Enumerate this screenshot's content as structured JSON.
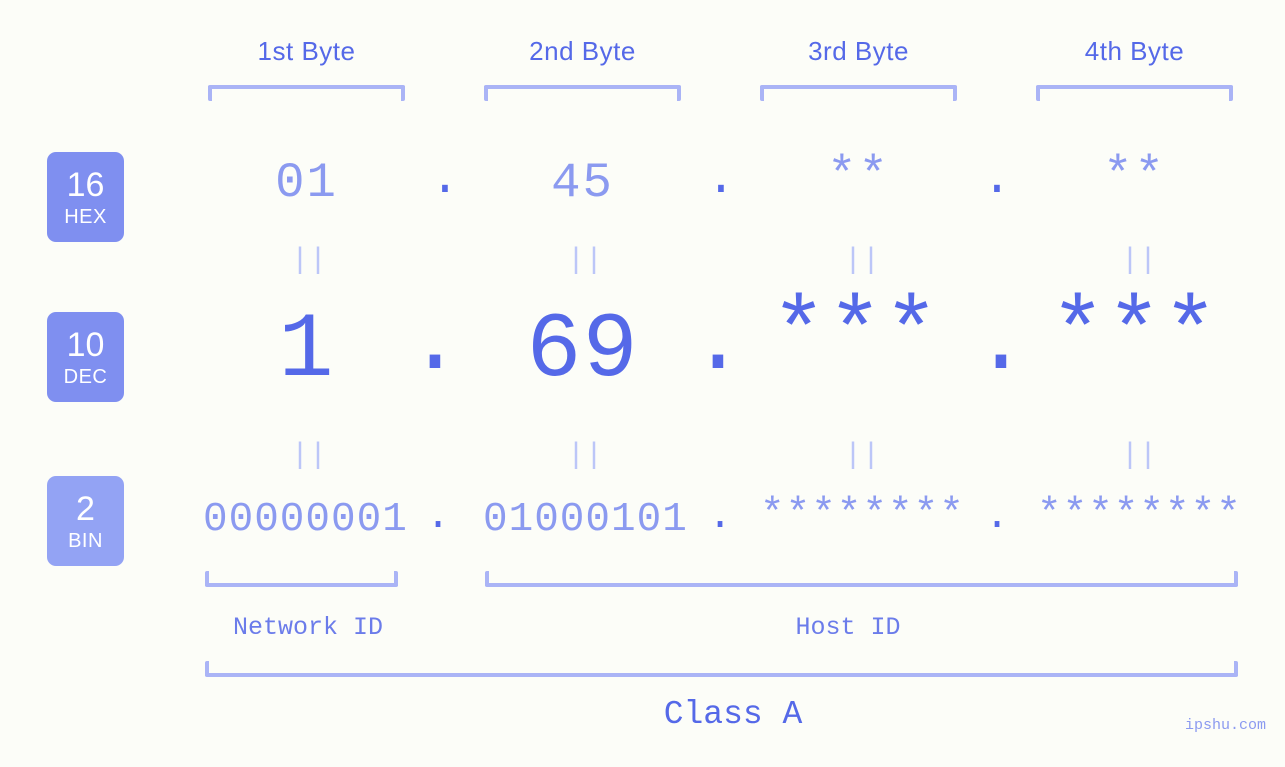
{
  "colors": {
    "background": "#fcfdf8",
    "accent_strong": "#5569e8",
    "accent_mid": "#8b9af0",
    "accent_light": "#aab4f6",
    "accent_faint": "#bcc6f8",
    "badge_hex": "#7f8ff0",
    "badge_dec": "#7f8ff0",
    "badge_bin": "#93a3f4",
    "badge_text": "#ffffff"
  },
  "byte_headers": [
    {
      "label": "1st Byte"
    },
    {
      "label": "2nd Byte"
    },
    {
      "label": "3rd Byte"
    },
    {
      "label": "4th Byte"
    }
  ],
  "rows": {
    "hex": {
      "base": "16",
      "unit": "HEX",
      "values": [
        "01",
        "45",
        "**",
        "**"
      ],
      "separator": "."
    },
    "dec": {
      "base": "10",
      "unit": "DEC",
      "values": [
        "1",
        "69",
        "***",
        "***"
      ],
      "separator": "."
    },
    "bin": {
      "base": "2",
      "unit": "BIN",
      "values": [
        "00000001",
        "01000101",
        "********",
        "********"
      ],
      "separator": "."
    }
  },
  "equals_mark": "||",
  "sections": [
    {
      "label": "Network ID"
    },
    {
      "label": "Host ID"
    }
  ],
  "class": {
    "label": "Class A"
  },
  "watermark": "ipshu.com"
}
